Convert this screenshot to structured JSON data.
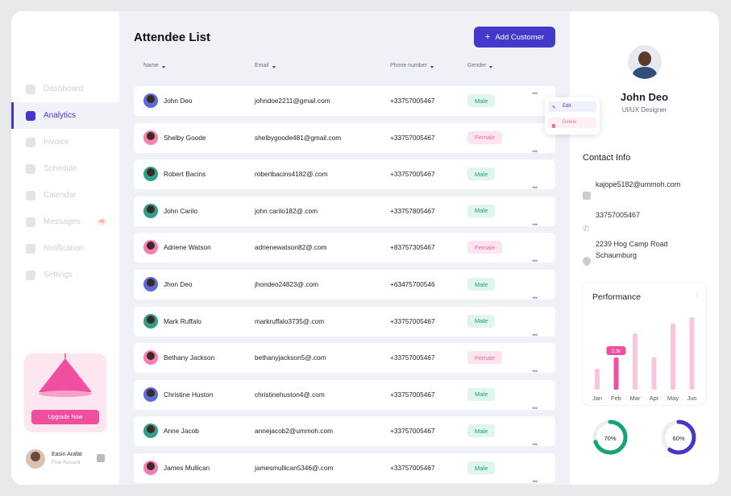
{
  "sidebar": {
    "items": [
      {
        "label": "Dashboard",
        "icon": "dashboard-icon",
        "active": false
      },
      {
        "label": "Analytics",
        "icon": "analytics-icon",
        "active": true
      },
      {
        "label": "Invoice",
        "icon": "invoice-icon",
        "active": false
      },
      {
        "label": "Schedule",
        "icon": "schedule-icon",
        "active": false
      },
      {
        "label": "Calendar",
        "icon": "calendar-icon",
        "active": false
      },
      {
        "label": "Messages",
        "icon": "messages-icon",
        "active": false,
        "badge": "49"
      },
      {
        "label": "Notification",
        "icon": "notification-icon",
        "active": false
      },
      {
        "label": "Settings",
        "icon": "settings-icon",
        "active": false
      }
    ],
    "upgrade_label": "Upgrade Now",
    "user": {
      "name": "Easin Arafat",
      "role": "Free Account"
    }
  },
  "main": {
    "title": "Attendee  List",
    "add_button": "Add Customer",
    "columns": [
      "Name",
      "Email",
      "Phone number",
      "Gender"
    ],
    "rows": [
      {
        "name": "John Deo",
        "email": "johndoe2211@gmail.com",
        "phone": "+33757005467",
        "gender": "Male"
      },
      {
        "name": "Shelby Goode",
        "email": "shelbygoode481@gmail.com",
        "phone": "+33757005467",
        "gender": "Female"
      },
      {
        "name": "Robert Bacins",
        "email": "robertbacins4182@.com",
        "phone": "+33757005467",
        "gender": "Male"
      },
      {
        "name": "John Carilo",
        "email": "john carilo182@.com",
        "phone": "+33757805467",
        "gender": "Male"
      },
      {
        "name": "Adriene Watson",
        "email": "adrienewatson82@.com",
        "phone": "+83757305467",
        "gender": "Female"
      },
      {
        "name": "Jhon Deo",
        "email": "jhondeo24823@.com",
        "phone": "+63475700546",
        "gender": "Male"
      },
      {
        "name": "Mark Ruffalo",
        "email": "markruffalo3735@.com",
        "phone": "+33757005467",
        "gender": "Male"
      },
      {
        "name": "Bethany Jackson",
        "email": "bethanyjackson5@.com",
        "phone": "+33757005467",
        "gender": "Female"
      },
      {
        "name": "Christine Huston",
        "email": "christinehuston4@.com",
        "phone": "+33757005467",
        "gender": "Male"
      },
      {
        "name": "Anne Jacob",
        "email": "annejacob2@ummoh.com",
        "phone": "+33757005467",
        "gender": "Male"
      },
      {
        "name": "James Mullican",
        "email": "jamesmullican5346@.com",
        "phone": "+33757005467",
        "gender": "Male"
      }
    ],
    "row_menu": {
      "edit": "Edit",
      "delete": "Delete"
    }
  },
  "right": {
    "name": "John Deo",
    "role": "UI/UX Designer",
    "contact_title": "Contact Info",
    "email": "kajope5182@ummoh.com",
    "phone": "33757005467",
    "address_line1": "2239  Hog Camp Road",
    "address_line2": "Schaumburg",
    "performance_title": "Performance"
  },
  "chart_data": {
    "type": "bar",
    "categories": [
      "Jan",
      "Feb",
      "Mar",
      "Apr",
      "May",
      "Jun"
    ],
    "series": [
      {
        "values": [
          2.6,
          4.0,
          7.0,
          4.0,
          8.2,
          9.0
        ]
      }
    ],
    "highlight": {
      "category": "Feb",
      "label": "2.3k"
    },
    "ylim": [
      0,
      10
    ],
    "colors": {
      "bar": "#f9c6dd",
      "highlight": "#f04fa0"
    }
  },
  "donuts": [
    {
      "label": "70%",
      "value": 70,
      "color": "#16a37a"
    },
    {
      "label": "60%",
      "value": 60,
      "color": "#4338ca"
    }
  ],
  "colors": {
    "accent": "#4338ca",
    "pink": "#f04fa0",
    "male": "#16a37a",
    "female": "#ec6aa4"
  }
}
